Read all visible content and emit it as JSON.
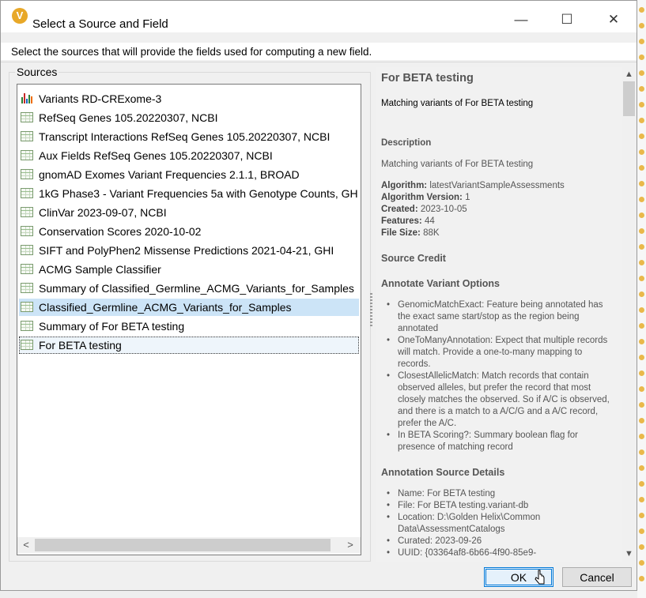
{
  "window": {
    "title": "Select a Source and Field",
    "icon_letter": "V",
    "controls": {
      "minimize": "—",
      "maximize": "☐",
      "close": "✕"
    }
  },
  "instruction": "Select the sources that will provide the fields used for computing a new field.",
  "sources": {
    "legend": "Sources",
    "items": [
      {
        "label": "Variants RD-CRExome-3",
        "icon": "variants-bars-icon"
      },
      {
        "label": "RefSeq Genes 105.20220307, NCBI",
        "icon": "table-icon"
      },
      {
        "label": "Transcript Interactions RefSeq Genes 105.20220307, NCBI",
        "icon": "table-icon"
      },
      {
        "label": "Aux Fields RefSeq Genes 105.20220307, NCBI",
        "icon": "table-icon"
      },
      {
        "label": "gnomAD Exomes Variant Frequencies 2.1.1, BROAD",
        "icon": "table-icon"
      },
      {
        "label": "1kG Phase3 - Variant Frequencies 5a with Genotype Counts, GH",
        "icon": "table-icon"
      },
      {
        "label": "ClinVar 2023-09-07, NCBI",
        "icon": "table-icon"
      },
      {
        "label": "Conservation Scores 2020-10-02",
        "icon": "table-icon"
      },
      {
        "label": "SIFT and PolyPhen2 Missense Predictions 2021-04-21, GHI",
        "icon": "table-icon"
      },
      {
        "label": "ACMG Sample Classifier",
        "icon": "table-icon"
      },
      {
        "label": "Summary of Classified_Germline_ACMG_Variants_for_Samples",
        "icon": "table-icon"
      },
      {
        "label": "Classified_Germline_ACMG_Variants_for_Samples",
        "icon": "table-icon",
        "state": "selected"
      },
      {
        "label": "Summary of For BETA testing",
        "icon": "table-icon"
      },
      {
        "label": "For BETA testing",
        "icon": "table-icon",
        "state": "focused"
      }
    ],
    "scroll_left": "<",
    "scroll_right": ">"
  },
  "detail": {
    "title": "For BETA testing",
    "subtitle": "Matching variants of For BETA testing",
    "description_heading": "Description",
    "description": "Matching variants of For BETA testing",
    "meta": [
      {
        "key": "Algorithm:",
        "value": "latestVariantSampleAssessments"
      },
      {
        "key": "Algorithm Version:",
        "value": "1"
      },
      {
        "key": "Created:",
        "value": "2023-10-05"
      },
      {
        "key": "Features:",
        "value": "44"
      },
      {
        "key": "File Size:",
        "value": "88K"
      }
    ],
    "source_credit_heading": "Source Credit",
    "annotate_heading": "Annotate Variant Options",
    "annotate_options": [
      "GenomicMatchExact: Feature being annotated has the exact same start/stop as the region being annotated",
      "OneToManyAnnotation: Expect that multiple records will match. Provide a one-to-many mapping to records.",
      "ClosestAllelicMatch: Match records that contain observed alleles, but prefer the record that most closely matches the observed. So if A/C is observed, and there is a match to a A/C/G and a A/C record, prefer the A/C.",
      "In BETA Scoring?: Summary boolean flag for presence of matching record"
    ],
    "source_details_heading": "Annotation Source Details",
    "source_details": [
      "Name: For BETA testing",
      "File: For BETA testing.variant-db",
      "Location: D:\\Golden Helix\\Common Data\\AssessmentCatalogs",
      "Curated: 2023-09-26",
      "UUID: {03364af8-6b66-4f90-85e9-"
    ],
    "scroll_up": "▲",
    "scroll_down": "▼"
  },
  "buttons": {
    "ok": "OK",
    "cancel": "Cancel"
  },
  "colors": {
    "selection": "#cce4f7",
    "accent": "#0078d7",
    "app_icon": "#e8a828"
  }
}
